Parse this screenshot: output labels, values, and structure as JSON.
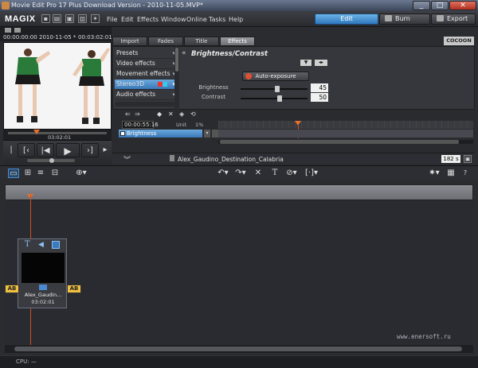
{
  "window": {
    "title": "Movie Edit Pro 17 Plus Download Version - 2010-11-05.MVP*",
    "buttons": {
      "minimize": "_",
      "maximize": "□",
      "close": "✕"
    }
  },
  "menubar": {
    "logo": "MAGIX",
    "items": [
      "File",
      "Edit",
      "Effects",
      "Window",
      "Online",
      "Tasks",
      "Help"
    ],
    "modes": {
      "edit": "Edit",
      "burn": "Burn",
      "export": "Export"
    }
  },
  "preview": {
    "time_left": "00:00:00:00",
    "project_date": "2010-11-05 *",
    "time_right": "00:03:02:01",
    "slider_time": "03:02:01"
  },
  "tabs": [
    "Import",
    "Fades",
    "Title",
    "Effects"
  ],
  "brand": "COCOON",
  "effects_list": [
    {
      "label": "Presets"
    },
    {
      "label": "Video effects"
    },
    {
      "label": "Movement effects"
    },
    {
      "label": "Stereo3D"
    },
    {
      "label": "Audio effects"
    }
  ],
  "effect_detail": {
    "title": "Brightness/Contrast",
    "auto_exposure": "Auto-exposure",
    "params": [
      {
        "label": "Brightness",
        "value": "45"
      },
      {
        "label": "Contrast",
        "value": "50"
      }
    ]
  },
  "fx_timeline": {
    "time": "00:00:55:16",
    "unit_label": "Unit",
    "unit_value": "1%",
    "track_label": "Brightness"
  },
  "project_bar": {
    "name": "Alex_Gaudino_Destination_Calabria",
    "zoom": "182 s"
  },
  "clip": {
    "title": "Alex_Gaudin...",
    "duration": "03:02:01",
    "ab_label": "AB"
  },
  "status": {
    "cpu": "CPU: —"
  },
  "watermark": "www.enersoft.ru",
  "colors": {
    "accent": "#3a8ad0",
    "playhead": "#e8702a"
  }
}
